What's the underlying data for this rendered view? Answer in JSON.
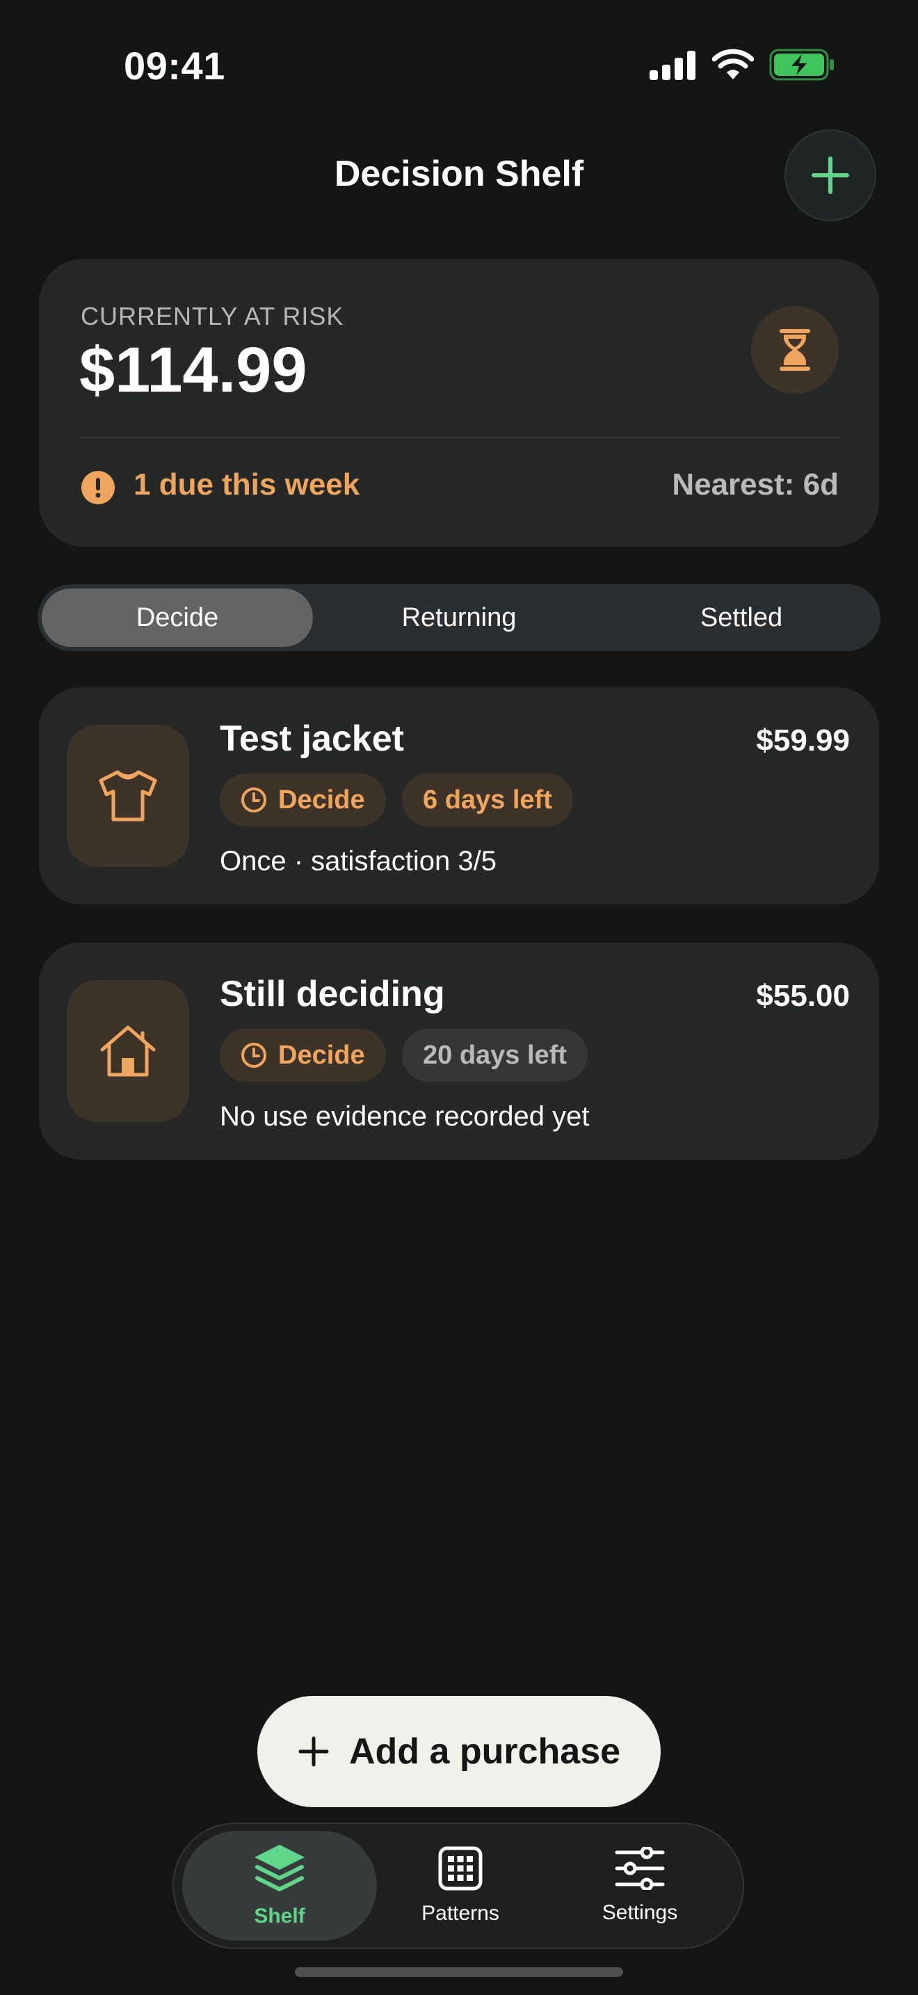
{
  "status_bar": {
    "time": "09:41"
  },
  "header": {
    "title": "Decision Shelf"
  },
  "risk_card": {
    "label": "CURRENTLY AT RISK",
    "amount": "$114.99",
    "alert": "1 due this week",
    "nearest": "Nearest: 6d"
  },
  "segments": {
    "items": [
      {
        "label": "Decide",
        "active": true
      },
      {
        "label": "Returning",
        "active": false
      },
      {
        "label": "Settled",
        "active": false
      }
    ]
  },
  "items": [
    {
      "title": "Test jacket",
      "price": "$59.99",
      "icon": "shirt-icon",
      "status_chip": "Decide",
      "days_chip": "6 days left",
      "note": "Once · satisfaction 3/5"
    },
    {
      "title": "Still deciding",
      "price": "$55.00",
      "icon": "home-icon",
      "status_chip": "Decide",
      "days_chip": "20 days left",
      "note": "No use evidence recorded yet"
    }
  ],
  "fab": {
    "label": "Add a purchase"
  },
  "tabbar": {
    "items": [
      {
        "label": "Shelf",
        "icon": "layers-icon",
        "active": true
      },
      {
        "label": "Patterns",
        "icon": "grid-icon",
        "active": false
      },
      {
        "label": "Settings",
        "icon": "sliders-icon",
        "active": false
      }
    ]
  },
  "colors": {
    "background": "#141515",
    "card": "#262828",
    "accent_green": "#5fd68a",
    "warm": "#f0a55f",
    "warm_bg": "#3e3329",
    "battery_green": "#3ec45a"
  }
}
